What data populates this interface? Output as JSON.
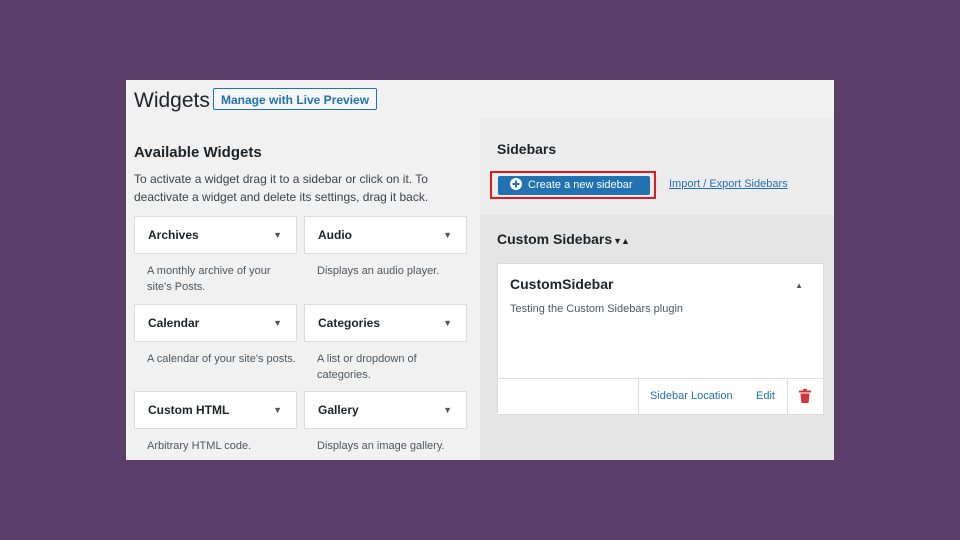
{
  "header": {
    "title": "Widgets",
    "live_preview_label": "Manage with Live Preview"
  },
  "available": {
    "title": "Available Widgets",
    "description": "To activate a widget drag it to a sidebar or click on it. To deactivate a widget and delete its settings, drag it back.",
    "widgets": [
      {
        "title": "Archives",
        "desc": "A monthly archive of your site's Posts."
      },
      {
        "title": "Audio",
        "desc": "Displays an audio player."
      },
      {
        "title": "Calendar",
        "desc": "A calendar of your site's posts."
      },
      {
        "title": "Categories",
        "desc": "A list or dropdown of categories."
      },
      {
        "title": "Custom HTML",
        "desc": "Arbitrary HTML code."
      },
      {
        "title": "Gallery",
        "desc": "Displays an image gallery."
      }
    ]
  },
  "sidebars": {
    "title": "Sidebars",
    "create_label": "Create a new sidebar",
    "import_label": "Import / Export Sidebars",
    "custom_title": "Custom Sidebars",
    "box": {
      "title": "CustomSidebar",
      "description": "Testing the Custom Sidebars plugin",
      "location_label": "Sidebar Location",
      "edit_label": "Edit"
    }
  },
  "colors": {
    "accent": "#2271b1",
    "highlight": "#e01b24",
    "delete": "#d63638",
    "backdrop": "#5b3d6a"
  }
}
